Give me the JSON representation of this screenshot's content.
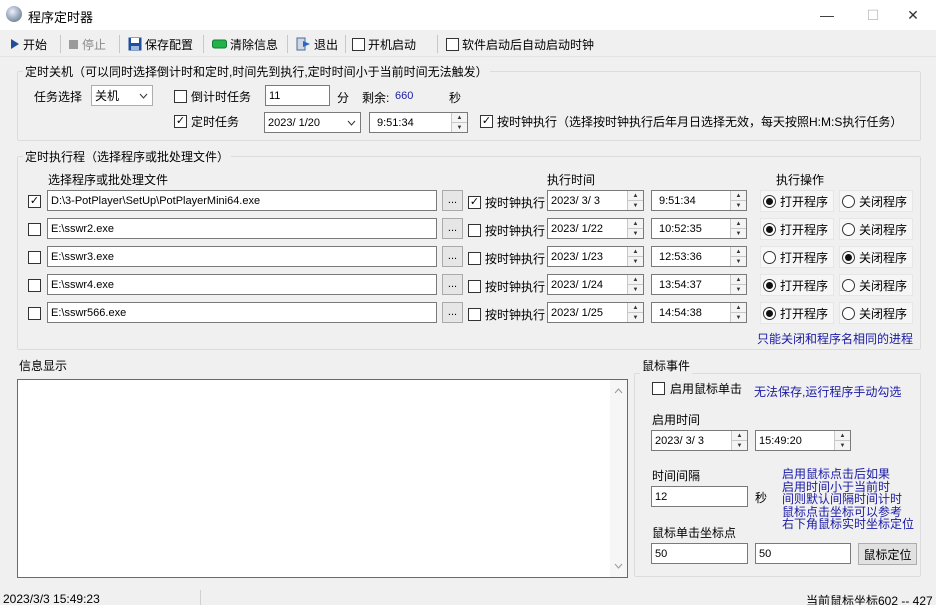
{
  "window": {
    "title": "程序定时器",
    "minimize": "—",
    "maximize": "☐",
    "close": "✕"
  },
  "toolbar": {
    "start": "开始",
    "stop": "停止",
    "save": "保存配置",
    "clear": "清除信息",
    "exit": "退出",
    "boot_start": "开机启动",
    "auto_clock": "软件启动后自动启动时钟"
  },
  "shutdown": {
    "title": "定时关机（可以同时选择倒计时和定时,时间先到执行,定时时间小于当前时间无法触发）",
    "task_label": "任务选择",
    "task_value": "关机",
    "countdown_label": "倒计时任务",
    "countdown_value": "11",
    "minute_unit": "分",
    "remaining_label": "剩余:",
    "remaining_value": "660",
    "second_unit": "秒",
    "timed_label": "定时任务",
    "timed_checked": true,
    "date_value": "2023/  1/20",
    "time_value": "9:51:34",
    "clock_label": "按时钟执行（选择按时钟执行后年月日选择无效，每天按照H:M:S执行任务）",
    "clock_checked": true
  },
  "schedule": {
    "title": "定时执行程（选择程序或批处理文件）",
    "col_file": "选择程序或批处理文件",
    "col_time": "执行时间",
    "col_action": "执行操作",
    "dots": "...",
    "clock_label": "按时钟执行",
    "open_label": "打开程序",
    "close_label": "关闭程序",
    "rows": [
      {
        "checked": true,
        "path": "D:\\3-PotPlayer\\SetUp\\PotPlayerMini64.exe",
        "clock": true,
        "date": "2023/  3/  3",
        "time": "9:51:34",
        "open": true
      },
      {
        "checked": false,
        "path": "E:\\sswr2.exe",
        "clock": false,
        "date": "2023/  1/22",
        "time": "10:52:35",
        "open": true
      },
      {
        "checked": false,
        "path": "E:\\sswr3.exe",
        "clock": false,
        "date": "2023/  1/23",
        "time": "12:53:36",
        "open": false
      },
      {
        "checked": false,
        "path": "E:\\sswr4.exe",
        "clock": false,
        "date": "2023/  1/24",
        "time": "13:54:37",
        "open": true
      },
      {
        "checked": false,
        "path": "E:\\sswr566.exe",
        "clock": false,
        "date": "2023/  1/25",
        "time": "14:54:38",
        "open": true
      }
    ],
    "note": "只能关闭和程序名相同的进程"
  },
  "info": {
    "title": "信息显示"
  },
  "mouse": {
    "title": "鼠标事件",
    "enable_label": "启用鼠标单击",
    "enable_note": "无法保存,运行程序手动勾选",
    "start_time_label": "启用时间",
    "start_date": "2023/  3/  3",
    "start_time": "15:49:20",
    "interval_label": "时间间隔",
    "interval_value": "12",
    "interval_unit": "秒",
    "notes": [
      "启用鼠标点击后如果",
      "启用时间小于当前时",
      "间则默认间隔时间计时",
      "鼠标点击坐标可以参考",
      "右下角鼠标实时坐标定位"
    ],
    "coord_label": "鼠标单击坐标点",
    "x_value": "50",
    "y_value": "50",
    "locate_button": "鼠标定位"
  },
  "status": {
    "datetime": "2023/3/3 15:49:23",
    "mouse_pos": "当前鼠标坐标602 -- 427"
  }
}
